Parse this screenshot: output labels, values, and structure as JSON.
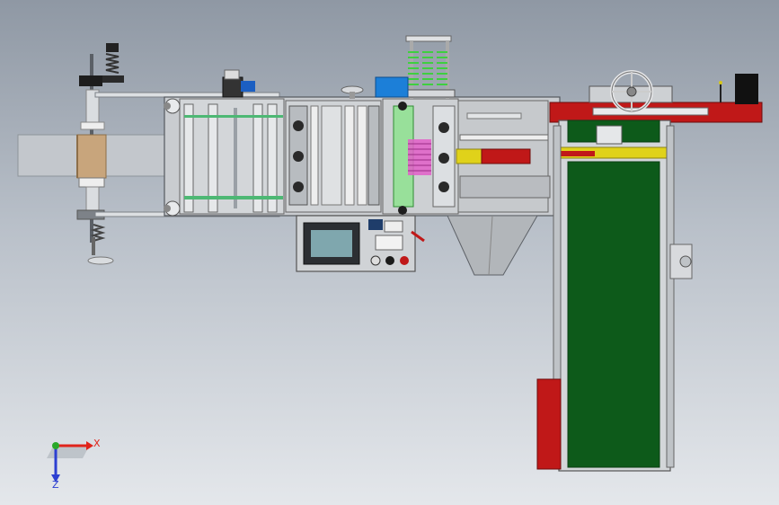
{
  "triad": {
    "x_label": "X",
    "z_label": "Z",
    "x_color": "#e0241b",
    "y_color": "#29a828",
    "z_color": "#2c3fd1"
  },
  "colors": {
    "background_top": "#8f98a4",
    "background_bottom": "#e4e7eb",
    "frame_gray": "#c9ccd0",
    "conveyor_belt": "#0d5a1a",
    "accent_red": "#c01818",
    "accent_yellow": "#e0d21a",
    "spring_green": "#3fcf3f",
    "blue_box": "#1c7fd8",
    "hmi_screen": "#7fa7ae",
    "paper_roll": "#c8a57c",
    "film_pink": "#e25fc8"
  }
}
